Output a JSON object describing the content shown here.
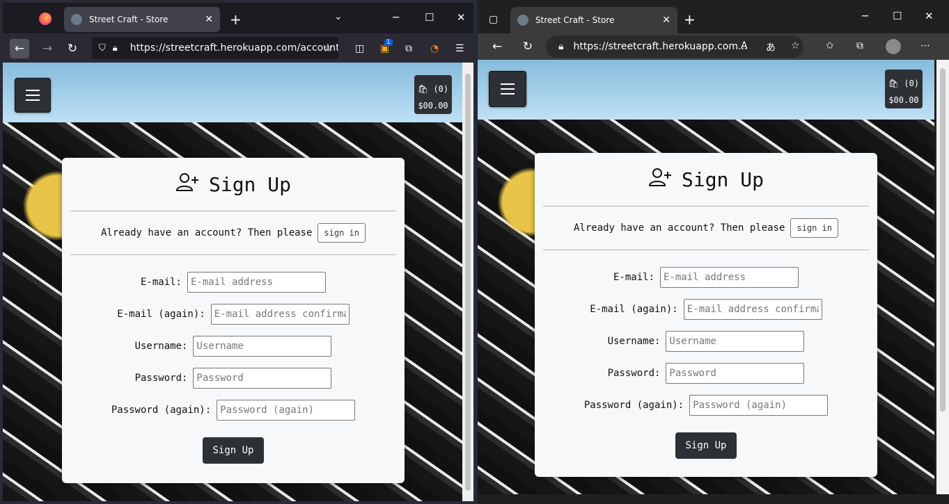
{
  "firefox": {
    "tab_title": "Street Craft - Store",
    "url": "https://streetcraft.herokuapp.com/account",
    "badge_count": "1"
  },
  "edge": {
    "tab_title": "Street Craft - Store",
    "url": "https://streetcraft.herokuapp.com..."
  },
  "site": {
    "cart_count": "(0)",
    "cart_total": "$00.00"
  },
  "signup": {
    "title": "Sign Up",
    "already_text": "Already have an account? Then please",
    "signin_label": "sign in",
    "email_label": "E-mail:",
    "email_placeholder": "E-mail address",
    "email2_label": "E-mail (again):",
    "email2_placeholder": "E-mail address confirmation",
    "username_label": "Username:",
    "username_placeholder": "Username",
    "password_label": "Password:",
    "password_placeholder": "Password",
    "password2_label": "Password (again):",
    "password2_placeholder": "Password (again)",
    "submit_label": "Sign Up"
  },
  "colors": {
    "header_top": "#86bcdc",
    "header_bottom": "#bfe0f4",
    "button_dark": "#2d3035",
    "card_bg": "#f6f8fa"
  }
}
